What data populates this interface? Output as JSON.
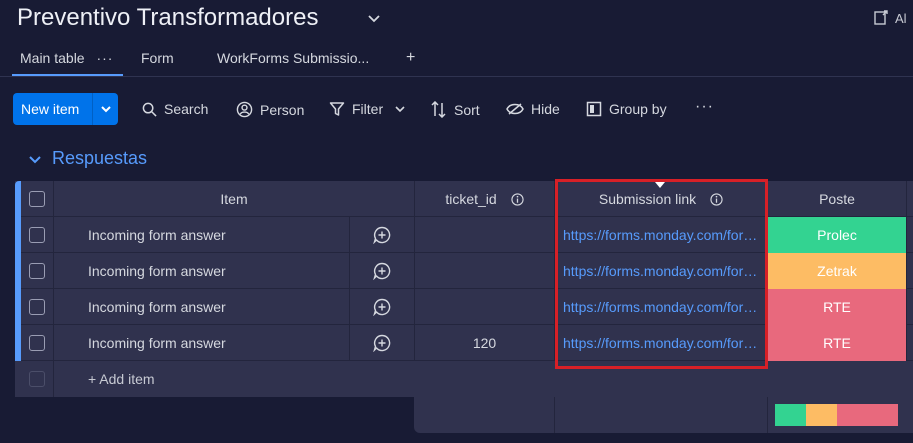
{
  "board": {
    "title": "Preventivo Transformadores",
    "top_right_label": "Al"
  },
  "tabs": [
    {
      "label": "Main table",
      "active": true
    },
    {
      "label": "Form"
    },
    {
      "label": "WorkForms Submissio..."
    }
  ],
  "toolbar": {
    "new_item_label": "New item",
    "search_label": "Search",
    "person_label": "Person",
    "filter_label": "Filter",
    "sort_label": "Sort",
    "hide_label": "Hide",
    "group_by_label": "Group by"
  },
  "group": {
    "title": "Respuestas",
    "color": "#579bfc"
  },
  "table": {
    "columns": [
      "Item",
      "ticket_id",
      "Submission link",
      "Poste"
    ],
    "rows": [
      {
        "item": "Incoming form answer",
        "ticket_id": "",
        "link": "https://forms.monday.com/forms/submissions",
        "poste": "Prolec",
        "poste_color": "#33d391"
      },
      {
        "item": "Incoming form answer",
        "ticket_id": "",
        "link": "https://forms.monday.com/forms/submissions",
        "poste": "Zetrak",
        "poste_color": "#fdbc64"
      },
      {
        "item": "Incoming form answer",
        "ticket_id": "",
        "link": "https://forms.monday.com/forms/submissions",
        "poste": "RTE",
        "poste_color": "#e8697d"
      },
      {
        "item": "Incoming form answer",
        "ticket_id": "120",
        "link": "https://forms.monday.com/forms/submissions",
        "poste": "RTE",
        "poste_color": "#e8697d"
      }
    ],
    "add_item_label": "+ Add item"
  },
  "summary": {
    "poste_distribution": [
      {
        "color": "#33d391",
        "fraction": 0.25
      },
      {
        "color": "#fdbc64",
        "fraction": 0.25
      },
      {
        "color": "#e8697d",
        "fraction": 0.5
      }
    ]
  },
  "colors": {
    "accent": "#0073ea",
    "highlight": "#d72027",
    "background": "#181b34"
  }
}
